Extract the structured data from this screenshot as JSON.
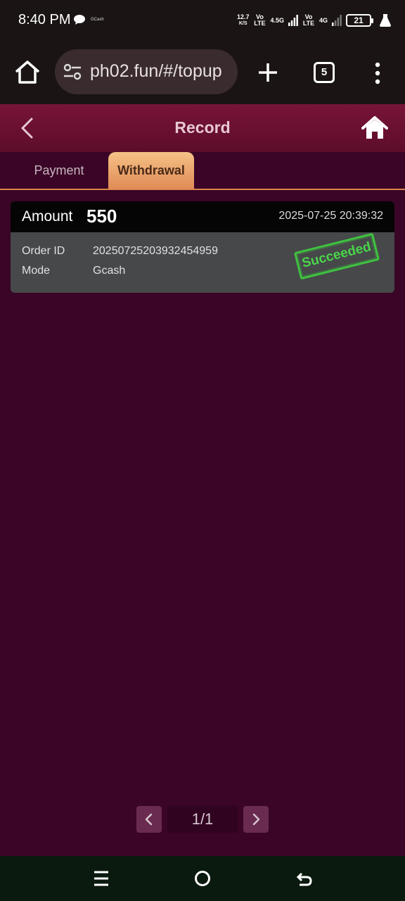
{
  "status_bar": {
    "time": "8:40 PM",
    "notification_app": "GCash",
    "net_speed": "12.7",
    "net_speed_unit": "K/S",
    "sim1_label": "Vo LTE",
    "sim1_network": "4.5G",
    "sim2_label": "Vo LTE",
    "sim2_network": "4G",
    "battery": "21"
  },
  "browser": {
    "url": "ph02.fun/#/topup",
    "tab_count": "5"
  },
  "header": {
    "title": "Record"
  },
  "tabs": [
    {
      "label": "Payment",
      "active": false
    },
    {
      "label": "Withdrawal",
      "active": true
    }
  ],
  "records": [
    {
      "amount_label": "Amount",
      "amount": "550",
      "datetime": "2025-07-25 20:39:32",
      "order_id_label": "Order ID",
      "order_id": "20250725203932454959",
      "mode_label": "Mode",
      "mode": "Gcash",
      "status": "Succeeded"
    }
  ],
  "pagination": {
    "text": "1/1"
  },
  "colors": {
    "page_bg": "#3a0526",
    "header_bg": "#781439",
    "active_tab": "#f5c287",
    "stamp": "#3fc23f"
  }
}
